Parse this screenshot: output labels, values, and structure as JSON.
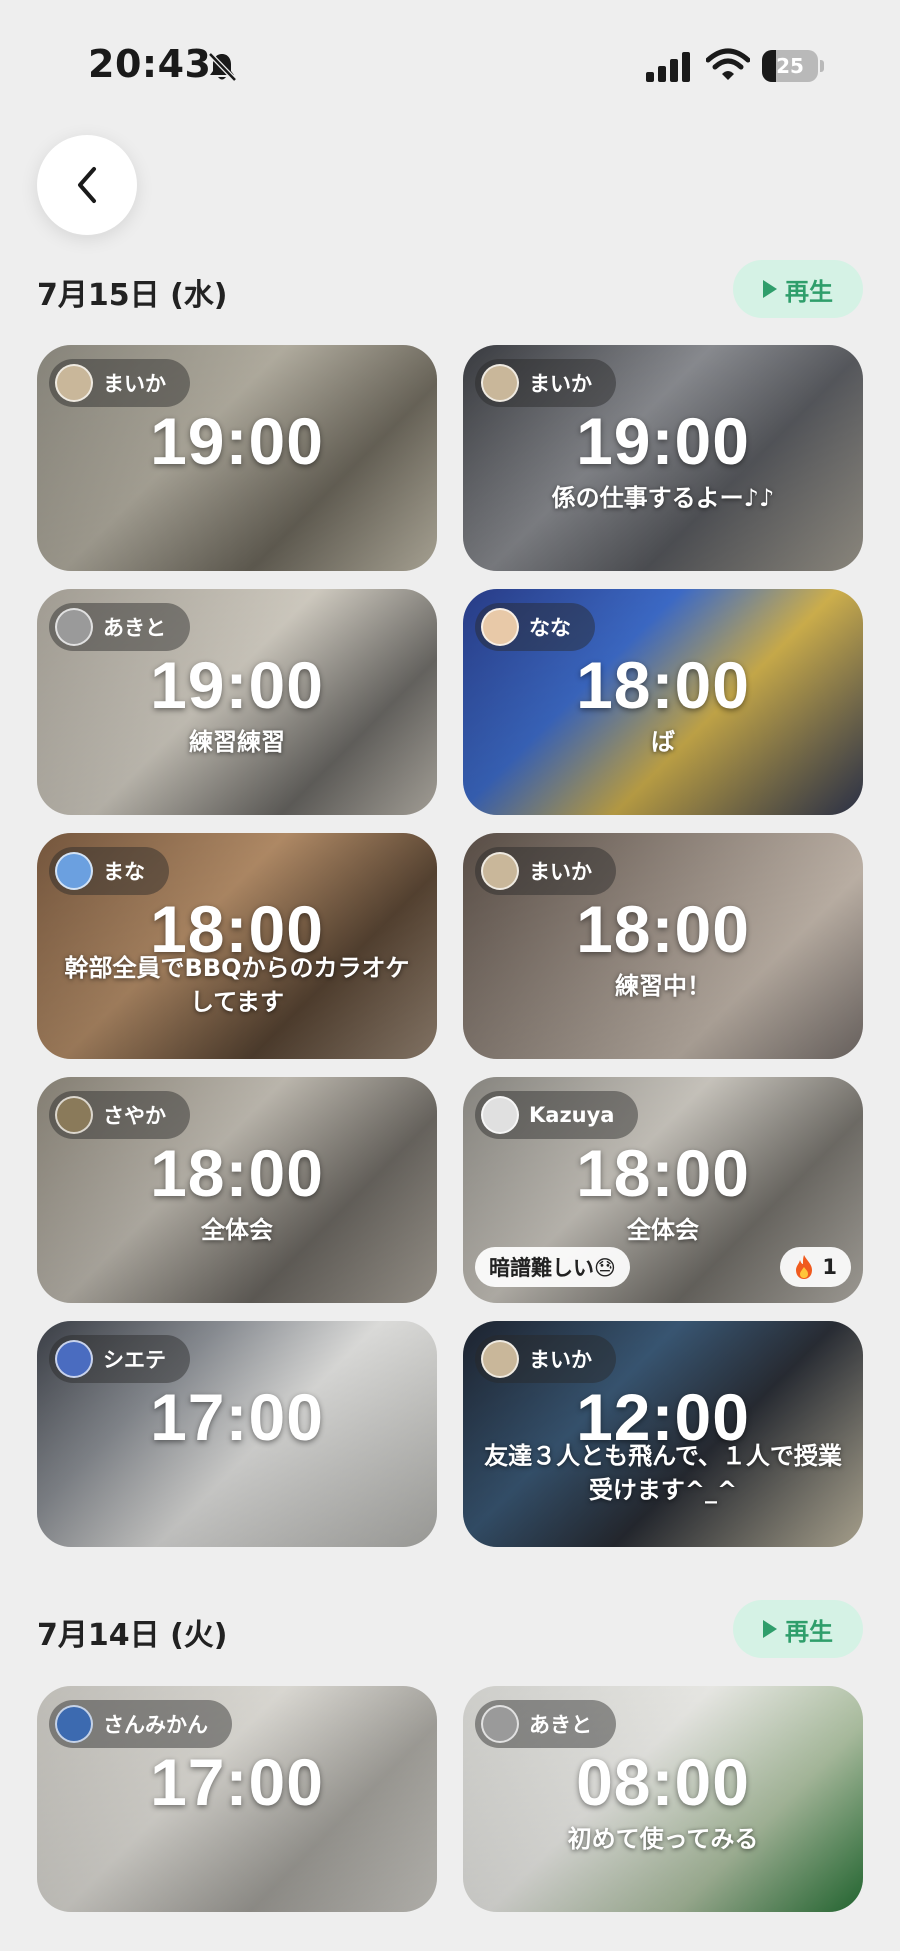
{
  "status_bar": {
    "time": "20:43",
    "battery": "25",
    "battery_level": 0.25
  },
  "sections": [
    {
      "date": "7月15日 (水)",
      "play_label": "再生",
      "cards": [
        {
          "user": "まいか",
          "time": "19:00",
          "caption": "",
          "avatar_color": "#c9b79a",
          "bg": "linear-gradient(135deg,#8d8a80 0%,#b9b4a6 40%,#6f6a5e 70%,#c8c2b0 100%)"
        },
        {
          "user": "まいか",
          "time": "19:00",
          "caption": "係の仕事するよー♪♪",
          "avatar_color": "#c9b79a",
          "bg": "linear-gradient(135deg,#3b3d42 0%,#8f9196 40%,#5a5c61 65%,#a7a296 100%)"
        },
        {
          "user": "あきと",
          "time": "19:00",
          "caption": "練習練習",
          "avatar_color": "#9a9a9a",
          "bg": "linear-gradient(135deg,#a9a49a 0%,#d8d3c8 45%,#6e6c68 75%,#c3beb4 100%)"
        },
        {
          "user": "なな",
          "time": "18:00",
          "caption": "ば",
          "avatar_color": "#e8c9a8",
          "bg": "linear-gradient(135deg,#2a3e8c 0%,#3f6fd0 35%,#d8b850 60%,#333a55 100%)"
        },
        {
          "user": "まな",
          "time": "18:00",
          "caption": "幹部全員でBBQからのカラオケしてます",
          "avatar_color": "#6ba0e0",
          "bg": "linear-gradient(135deg,#7a5a40 0%,#b8906a 40%,#5a4634 70%,#9c8a78 100%)"
        },
        {
          "user": "まいか",
          "time": "18:00",
          "caption": "練習中！",
          "avatar_color": "#c9b79a",
          "bg": "linear-gradient(135deg,#5c5048 0%,#9a8e84 40%,#c8bcb0 70%,#7c7470 100%)"
        },
        {
          "user": "さやか",
          "time": "18:00",
          "caption": "全体会",
          "avatar_color": "#8a7a5a",
          "bg": "linear-gradient(135deg,#8a8478 0%,#c4bfb5 40%,#6e6a64 70%,#b0aaa0 100%)"
        },
        {
          "user": "Kazuya",
          "time": "18:00",
          "caption": "全体会",
          "avatar_color": "#e0e0e0",
          "bg": "linear-gradient(135deg,#8c8a84 0%,#d0ccc4 40%,#75726c 70%,#bcb8b0 100%)",
          "comment": "暗譜難しい😓",
          "reaction": "1"
        },
        {
          "user": "シエテ",
          "time": "17:00",
          "caption": "",
          "avatar_color": "#4a6cc0",
          "bg": "linear-gradient(135deg,#3c4048 0%,#8e9298 30%,#e6e6e4 55%,#b8b8b4 100%)"
        },
        {
          "user": "まいか",
          "time": "12:00",
          "caption": "友達３人とも飛んで、１人で授業受けます^_^",
          "avatar_color": "#c9b79a",
          "bg": "linear-gradient(135deg,#1e2430 0%,#3b5a78 35%,#2a2e36 60%,#c8c0a8 100%)"
        }
      ]
    },
    {
      "date": "7月14日 (火)",
      "play_label": "再生",
      "cards": [
        {
          "user": "さんみかん",
          "time": "17:00",
          "caption": "",
          "avatar_color": "#3c6ab0",
          "bg": "linear-gradient(135deg,#c8c6c0 0%,#e4e2dc 40%,#a8a6a0 70%,#d4d2cc 100%)"
        },
        {
          "user": "あきと",
          "time": "08:00",
          "caption": "初めて使ってみる",
          "avatar_color": "#9a9a9a",
          "bg": "linear-gradient(135deg,#d8d8d4 0%,#f2f2ee 40%,#b4c8a8 70%,#2a7a3a 100%)"
        }
      ]
    }
  ]
}
